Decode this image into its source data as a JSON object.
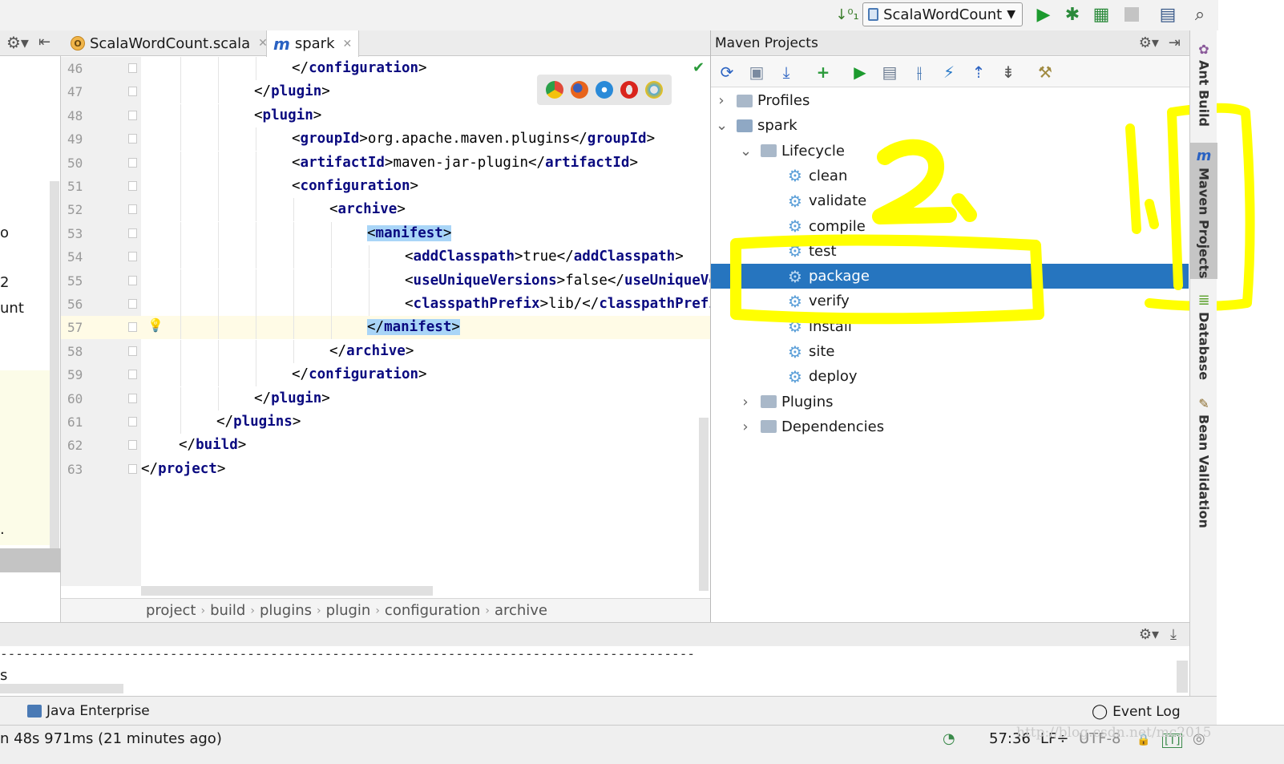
{
  "toolbar": {
    "run_config": "ScalaWordCount",
    "icons": [
      "sort-icon",
      "run-icon",
      "debug-icon",
      "coverage-icon",
      "stop-icon",
      "project-structure-icon",
      "search-icon"
    ]
  },
  "left_panel": {
    "fragments": [
      "o",
      "2",
      "unt",
      "."
    ]
  },
  "editor": {
    "tabs": [
      {
        "label": "ScalaWordCount.scala",
        "active": false
      },
      {
        "label": "spark",
        "active": true
      }
    ],
    "lines": [
      {
        "num": "46",
        "indent": 4,
        "text": "</configuration>"
      },
      {
        "num": "47",
        "indent": 3,
        "text": "</plugin>"
      },
      {
        "num": "48",
        "indent": 3,
        "text": "<plugin>"
      },
      {
        "num": "49",
        "indent": 4,
        "text": "<groupId>org.apache.maven.plugins</groupId>"
      },
      {
        "num": "50",
        "indent": 4,
        "text": "<artifactId>maven-jar-plugin</artifactId>"
      },
      {
        "num": "51",
        "indent": 4,
        "text": "<configuration>"
      },
      {
        "num": "52",
        "indent": 5,
        "text": "<archive>"
      },
      {
        "num": "53",
        "indent": 6,
        "text": "<manifest>"
      },
      {
        "num": "54",
        "indent": 7,
        "text": "<addClasspath>true</addClasspath>"
      },
      {
        "num": "55",
        "indent": 7,
        "text": "<useUniqueVersions>false</useUniqueVersions>"
      },
      {
        "num": "56",
        "indent": 7,
        "text": "<classpathPrefix>lib/</classpathPrefix>"
      },
      {
        "num": "57",
        "indent": 6,
        "text": "</manifest>"
      },
      {
        "num": "58",
        "indent": 5,
        "text": "</archive>"
      },
      {
        "num": "59",
        "indent": 4,
        "text": "</configuration>"
      },
      {
        "num": "60",
        "indent": 3,
        "text": "</plugin>"
      },
      {
        "num": "61",
        "indent": 2,
        "text": "</plugins>"
      },
      {
        "num": "62",
        "indent": 1,
        "text": "</build>"
      },
      {
        "num": "63",
        "indent": 0,
        "text": "</project>"
      }
    ],
    "breadcrumb": [
      "project",
      "build",
      "plugins",
      "plugin",
      "configuration",
      "archive"
    ]
  },
  "maven": {
    "title": "Maven Projects",
    "tree": [
      {
        "label": "Profiles",
        "level": 0,
        "type": "folder",
        "expanded": false
      },
      {
        "label": "spark",
        "level": 0,
        "type": "module",
        "expanded": true
      },
      {
        "label": "Lifecycle",
        "level": 1,
        "type": "folder",
        "expanded": true
      },
      {
        "label": "clean",
        "level": 2,
        "type": "goal"
      },
      {
        "label": "validate",
        "level": 2,
        "type": "goal"
      },
      {
        "label": "compile",
        "level": 2,
        "type": "goal"
      },
      {
        "label": "test",
        "level": 2,
        "type": "goal"
      },
      {
        "label": "package",
        "level": 2,
        "type": "goal",
        "selected": true
      },
      {
        "label": "verify",
        "level": 2,
        "type": "goal"
      },
      {
        "label": "install",
        "level": 2,
        "type": "goal"
      },
      {
        "label": "site",
        "level": 2,
        "type": "goal"
      },
      {
        "label": "deploy",
        "level": 2,
        "type": "goal"
      },
      {
        "label": "Plugins",
        "level": 1,
        "type": "folder",
        "expanded": false
      },
      {
        "label": "Dependencies",
        "level": 1,
        "type": "folder",
        "expanded": false
      }
    ]
  },
  "right_strip": {
    "tabs": [
      "Ant Build",
      "Maven Projects",
      "Database",
      "Bean Validation"
    ]
  },
  "bottom": {
    "console_dashes": "------------------------------------------------------------------------------------------",
    "console_fragment": "s",
    "tool_tabs": {
      "left": "Java Enterprise",
      "right": "Event Log"
    }
  },
  "status": {
    "message": "n 48s 971ms (21 minutes ago)",
    "position": "57:36",
    "line_sep": "LF÷",
    "encoding": "UTF-8",
    "watermark": "http://blog.csdn.net/mc2015"
  },
  "annotations": {
    "marks": [
      "2.",
      "1."
    ]
  },
  "colors": {
    "selection": "#2675bf",
    "tag": "#0a0a80",
    "highlight": "#a9d5f7",
    "annotation": "#ffff00"
  }
}
